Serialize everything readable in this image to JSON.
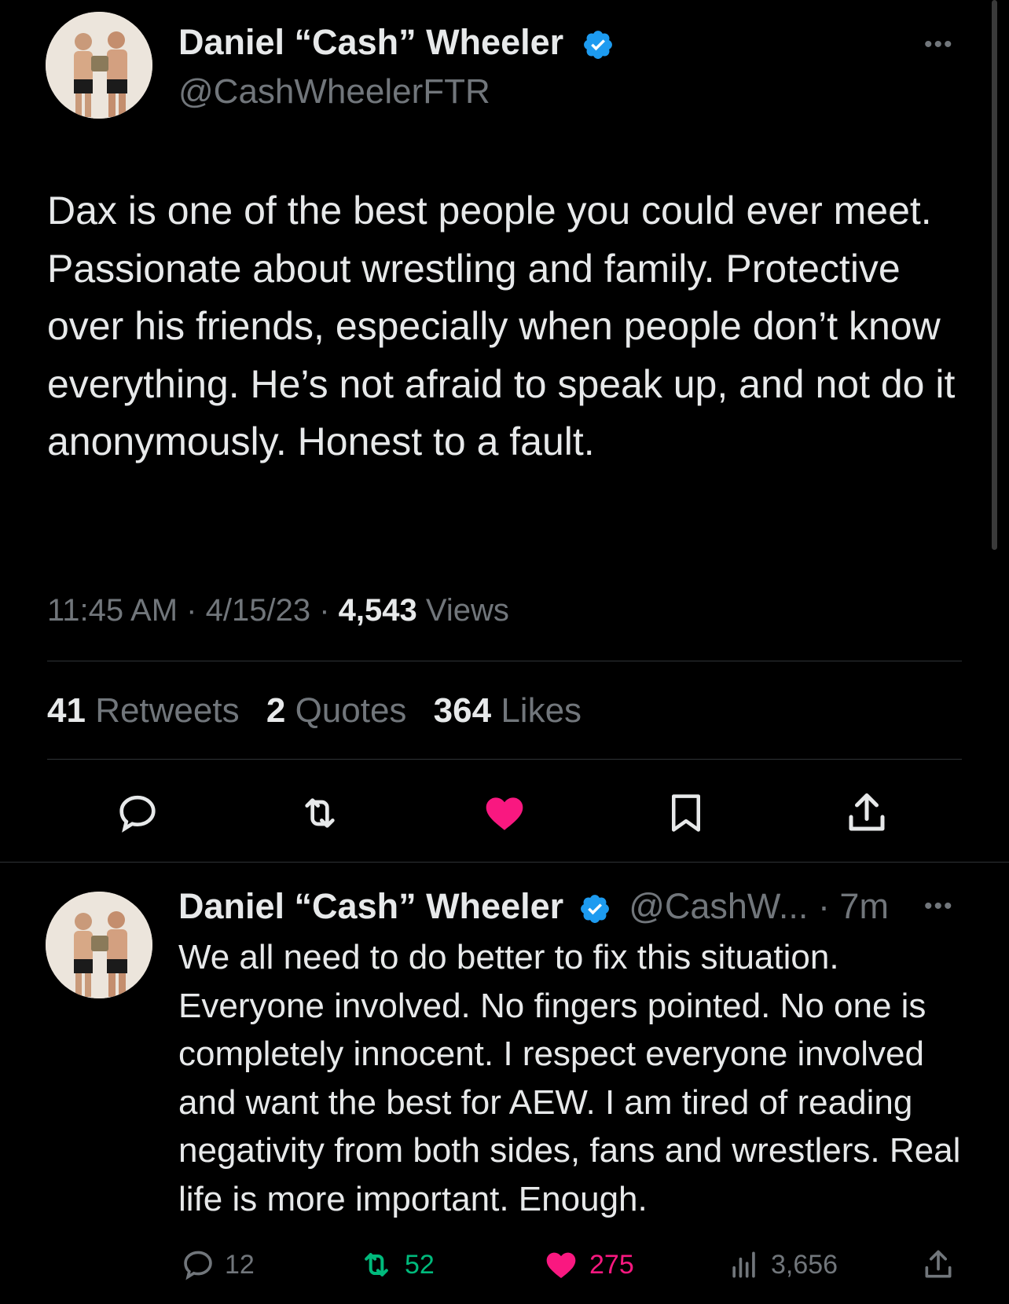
{
  "main_tweet": {
    "author_name": "Daniel “Cash” Wheeler",
    "handle": "@CashWheelerFTR",
    "text": "Dax is one of the best people you could ever meet. Passionate about wrestling and family. Protective over his friends, especially when people don’t know everything. He’s not afraid to speak up, and not do it anonymously. Honest to a fault.",
    "time": "11:45 AM",
    "date": "4/15/23",
    "separator": "·",
    "views_count": "4,543",
    "views_label": "Views",
    "retweets_count": "41",
    "retweets_label": "Retweets",
    "quotes_count": "2",
    "quotes_label": "Quotes",
    "likes_count": "364",
    "likes_label": "Likes",
    "actions": [
      "reply-icon",
      "retweet-icon",
      "like-icon",
      "bookmark-icon",
      "share-icon"
    ]
  },
  "reply_tweet": {
    "author_name": "Daniel “Cash” Wheeler",
    "handle": "@CashW...",
    "age": "· 7m",
    "text": "We all need to do better to fix this situation. Everyone involved. No fingers pointed. No one is completely innocent. I respect everyone involved and want the best for AEW. I am tired of reading negativity from both sides, fans and wrestlers. Real life is more important. Enough.",
    "replies": "12",
    "retweets": "52",
    "likes": "275",
    "views": "3,656"
  },
  "colors": {
    "background": "#000000",
    "text": "#e7e9ea",
    "secondary": "#71767b",
    "verified": "#1d9bf0",
    "like": "#f91880",
    "retweet": "#00ba7c",
    "divider": "#2f3336"
  }
}
